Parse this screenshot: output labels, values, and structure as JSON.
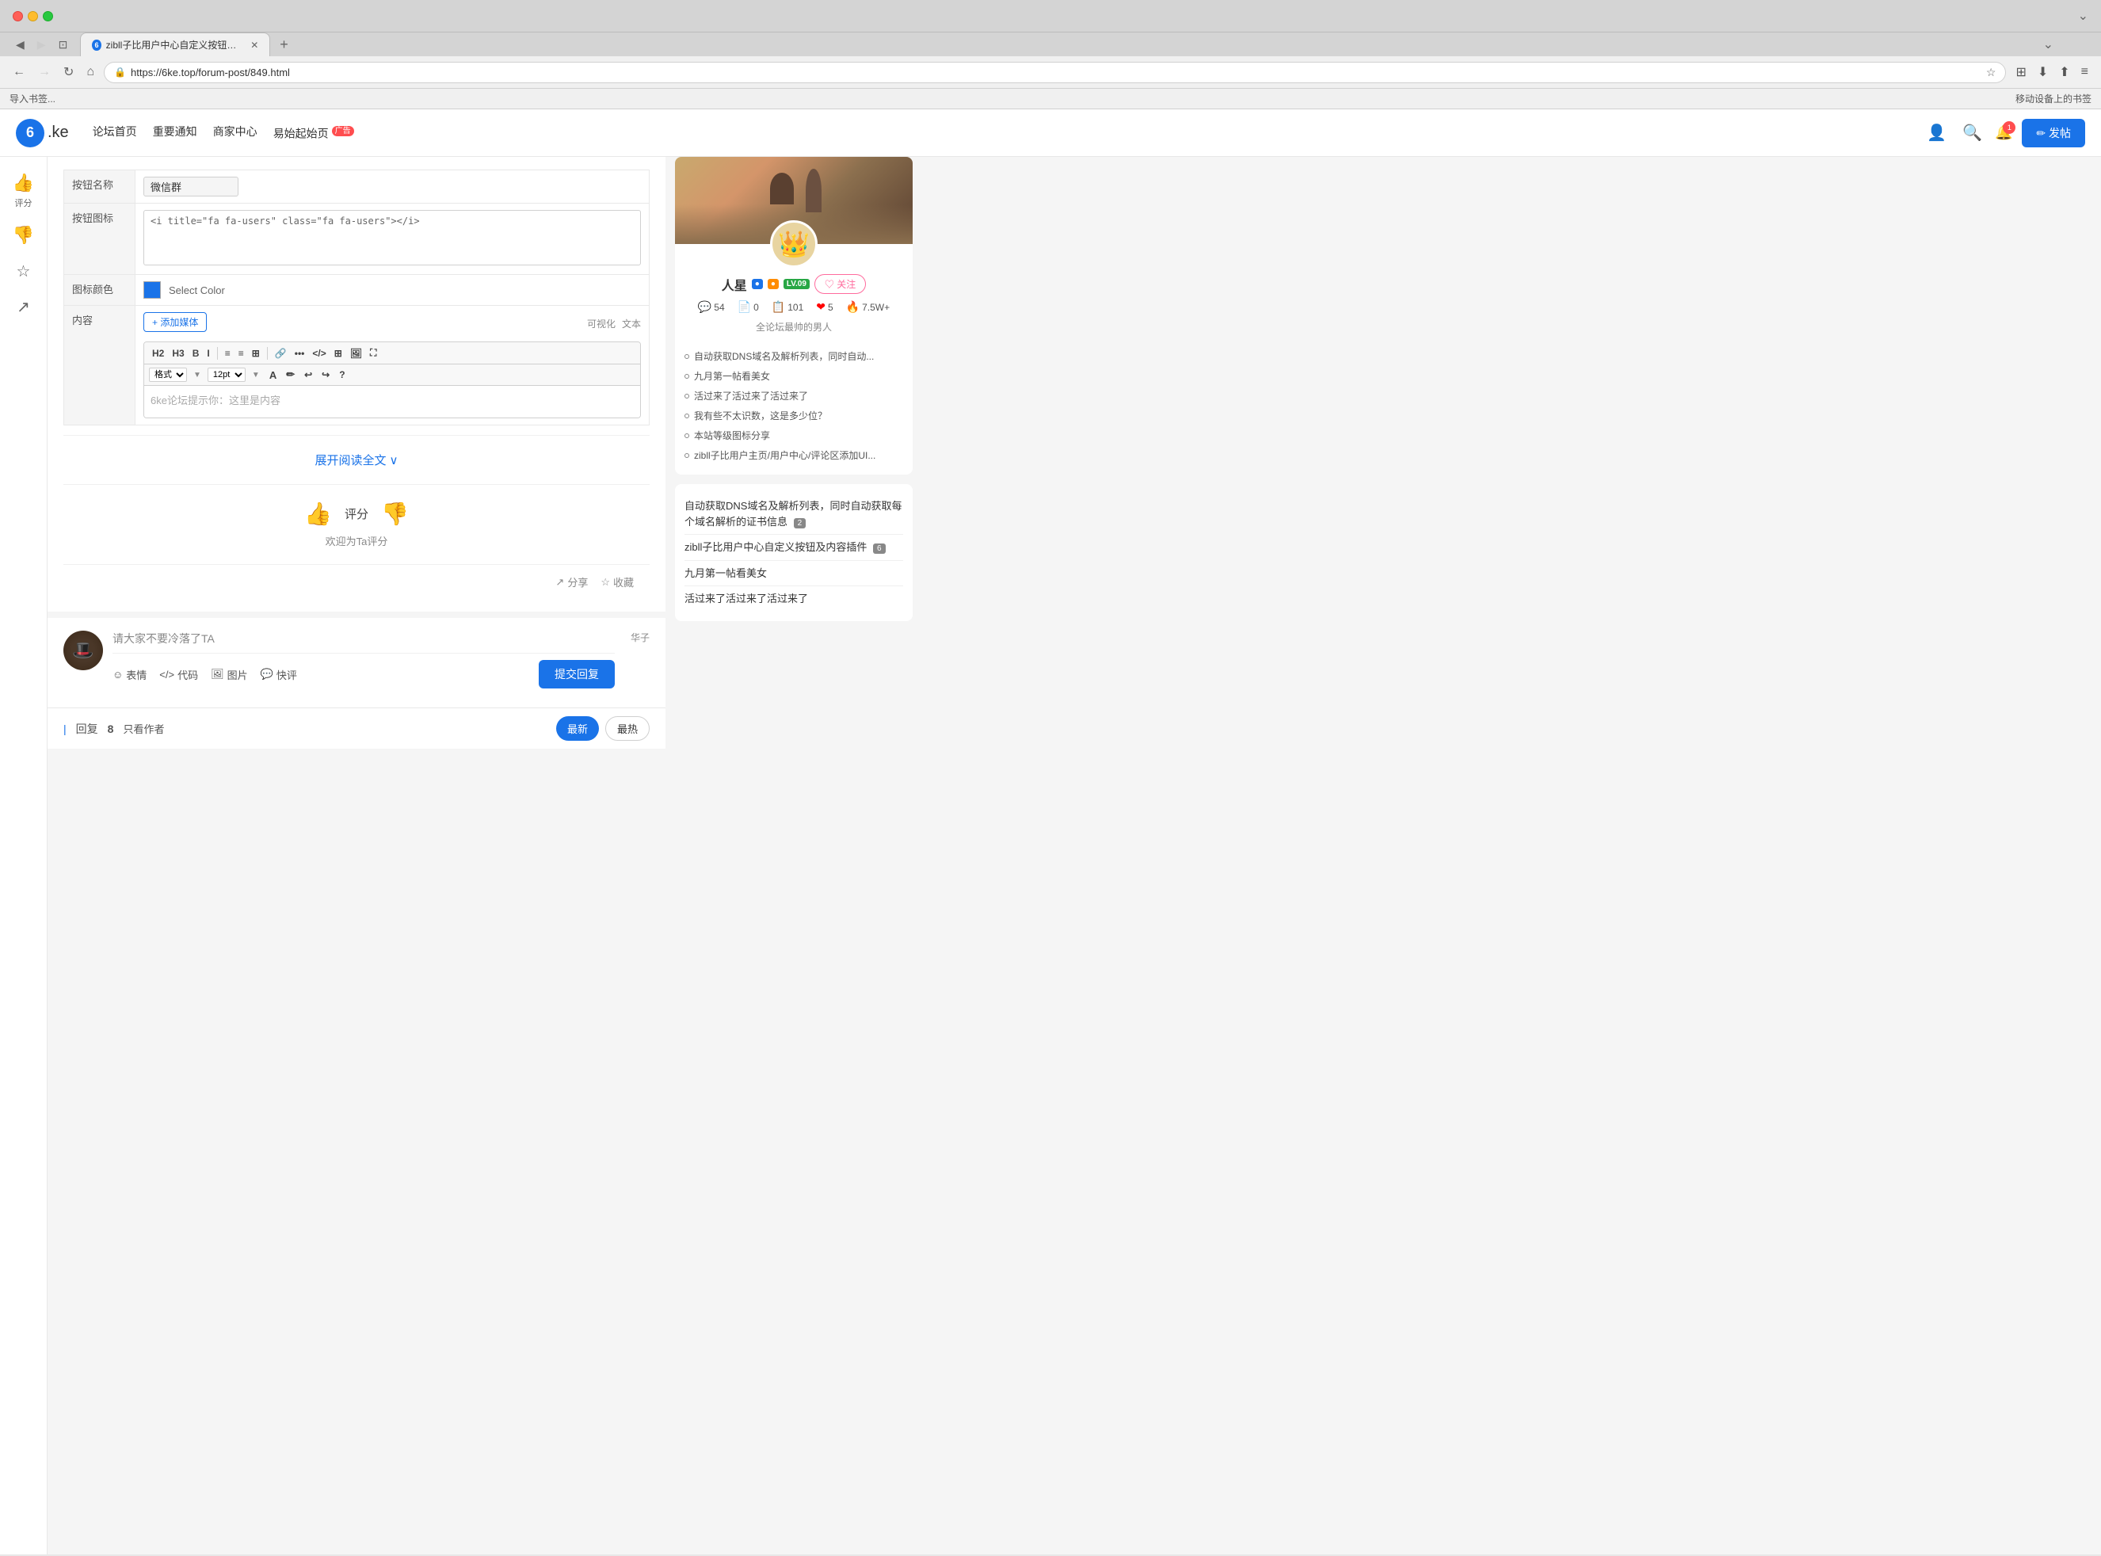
{
  "browser": {
    "tab_title": "zibll子比用户中心自定义按钮及内容插件",
    "tab_favicon": "6",
    "address": "https://6ke.top/forum-post/849.html",
    "bookmark": "导入书签...",
    "bookmark_right": "移动设备上的书签"
  },
  "sitenav": {
    "logo": "6",
    "logo_suffix": ".ke",
    "links": [
      {
        "label": "论坛首页"
      },
      {
        "label": "重要通知"
      },
      {
        "label": "商家中心"
      },
      {
        "label": "易始起始页",
        "ad": "广告"
      }
    ],
    "post_btn": "✏ 发帖",
    "notification_count": "1"
  },
  "form": {
    "label_name": "按钮名称",
    "label_icon": "按钮图标",
    "label_color": "图标颜色",
    "label_content": "内容",
    "name_value": "微信群",
    "icon_value": "<i title=\"fa fa-users\" class=\"fa fa-users\"></i>",
    "select_color_label": "Select Color",
    "content_tab1": "可视化",
    "content_tab2": "文本",
    "add_media_btn": "+ 添加媒体",
    "placeholder_content": "6ke论坛提示你：这里是内容",
    "toolbar_h2": "H2",
    "toolbar_h3": "H3",
    "toolbar_b": "B",
    "toolbar_i": "I",
    "toolbar_ol": "≡",
    "toolbar_ul": "≡",
    "toolbar_align": "≡",
    "toolbar_link": "🔗",
    "toolbar_more": "...",
    "toolbar_code": "</>",
    "toolbar_undo": "↩",
    "format_label": "格式",
    "size_label": "12pt"
  },
  "post": {
    "expand_btn": "展开阅读全文",
    "expand_icon": "∨",
    "rating_label": "评分",
    "welcome_text": "欢迎为Ta评分",
    "share_btn": "分享",
    "collect_btn": "收藏"
  },
  "comment": {
    "prompt": "请大家不要冷落了TA",
    "author_name": "华子",
    "emoji_btn": "表情",
    "code_btn": "代码",
    "image_btn": "图片",
    "quick_btn": "快评",
    "submit_btn": "提交回复"
  },
  "footer": {
    "reply_label": "回复",
    "reply_count": "8",
    "author_only": "只看作者",
    "tab_latest": "最新",
    "tab_hot": "最热"
  },
  "user_card": {
    "name": "人星",
    "follow_btn": "♡ 关注",
    "stats": [
      {
        "icon": "💬",
        "value": "54"
      },
      {
        "icon": "📄",
        "value": "0"
      },
      {
        "icon": "📋",
        "value": "101"
      },
      {
        "icon": "❤",
        "value": "5",
        "color": "red"
      },
      {
        "icon": "🔥",
        "value": "7.5W+",
        "color": "orange"
      }
    ],
    "slogan": "全论坛最帅的男人",
    "links": [
      "自动获取DNS域名及解析列表，同时自动...",
      "九月第一帖看美女",
      "活过来了活过来了活过来了",
      "我有些不太识数，这是多少位？",
      "本站等级图标分享",
      "zibll子比用户主页/用户中心/评论区添加UI..."
    ]
  },
  "sidebar_articles": [
    "自动获取DNS域名及解析列表，同时自动获取每个域名解析的证书信息",
    "zibll子比用户中心自定义按钮及内容插件",
    "九月第一帖看美女",
    "活过来了活过来了活过来了"
  ],
  "sidebar_badges": {
    "article1_badge": "2",
    "article2_badge": "6"
  }
}
